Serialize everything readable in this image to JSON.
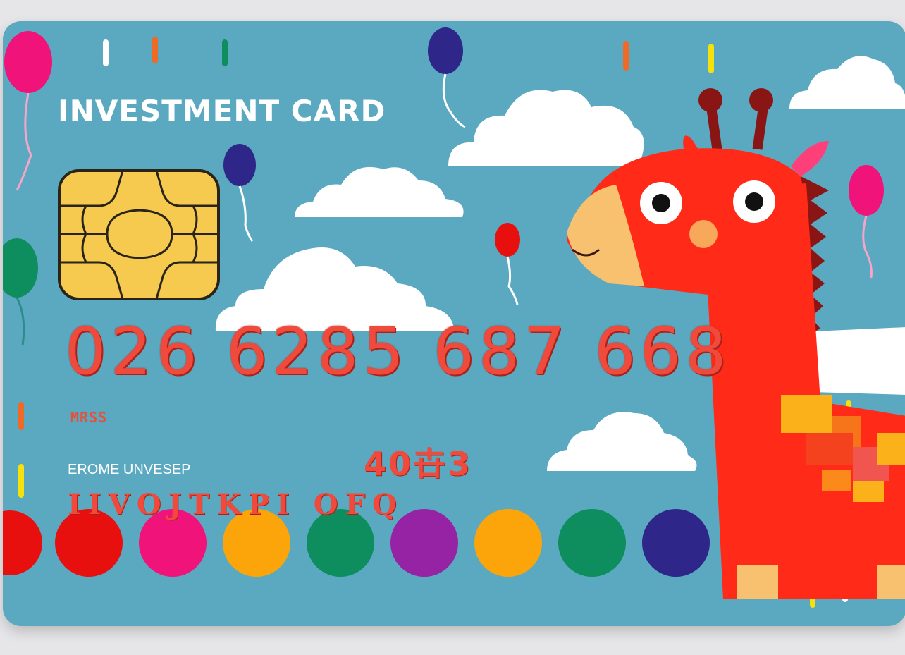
{
  "card": {
    "title": "INVESTMENT CARD",
    "number": "026 6285 687 668",
    "small_code": "MRSS",
    "expiry": "40卋3",
    "holder_label": "EROME UNVESEP",
    "holder_name": "IIVOJTKPI OFQ"
  },
  "colors": {
    "card_bg": "#5aa9c1",
    "giraffe": "#ff2a17",
    "number_text": "#ef4a3c"
  },
  "dots": [
    "#e80f0f",
    "#f0137a",
    "#fba50b",
    "#0e8d5e",
    "#9622a4",
    "#fba50b",
    "#0e8d5e",
    "#2e2789"
  ]
}
